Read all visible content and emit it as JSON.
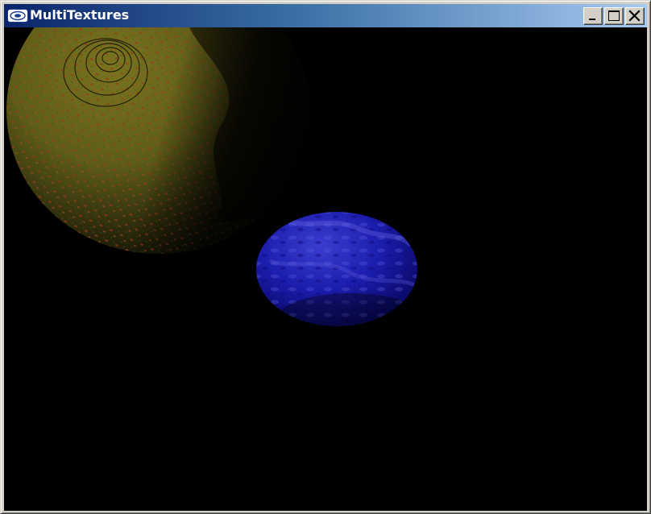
{
  "window": {
    "title": "MultiTextures",
    "app_icon": "opengl-logo-icon",
    "controls": {
      "minimize": "minimize-icon",
      "maximize": "maximize-icon",
      "close": "close-icon"
    }
  },
  "scene": {
    "background": "#000000",
    "objects": [
      {
        "name": "textured-planet-sphere",
        "texture_colors": [
          "#6b6a1a",
          "#8a3a1a",
          "#2c3a10"
        ]
      },
      {
        "name": "blue-planet-sphere",
        "texture_colors": [
          "#1a1aa8",
          "#3c3cd0",
          "#0e0e70"
        ]
      }
    ]
  }
}
